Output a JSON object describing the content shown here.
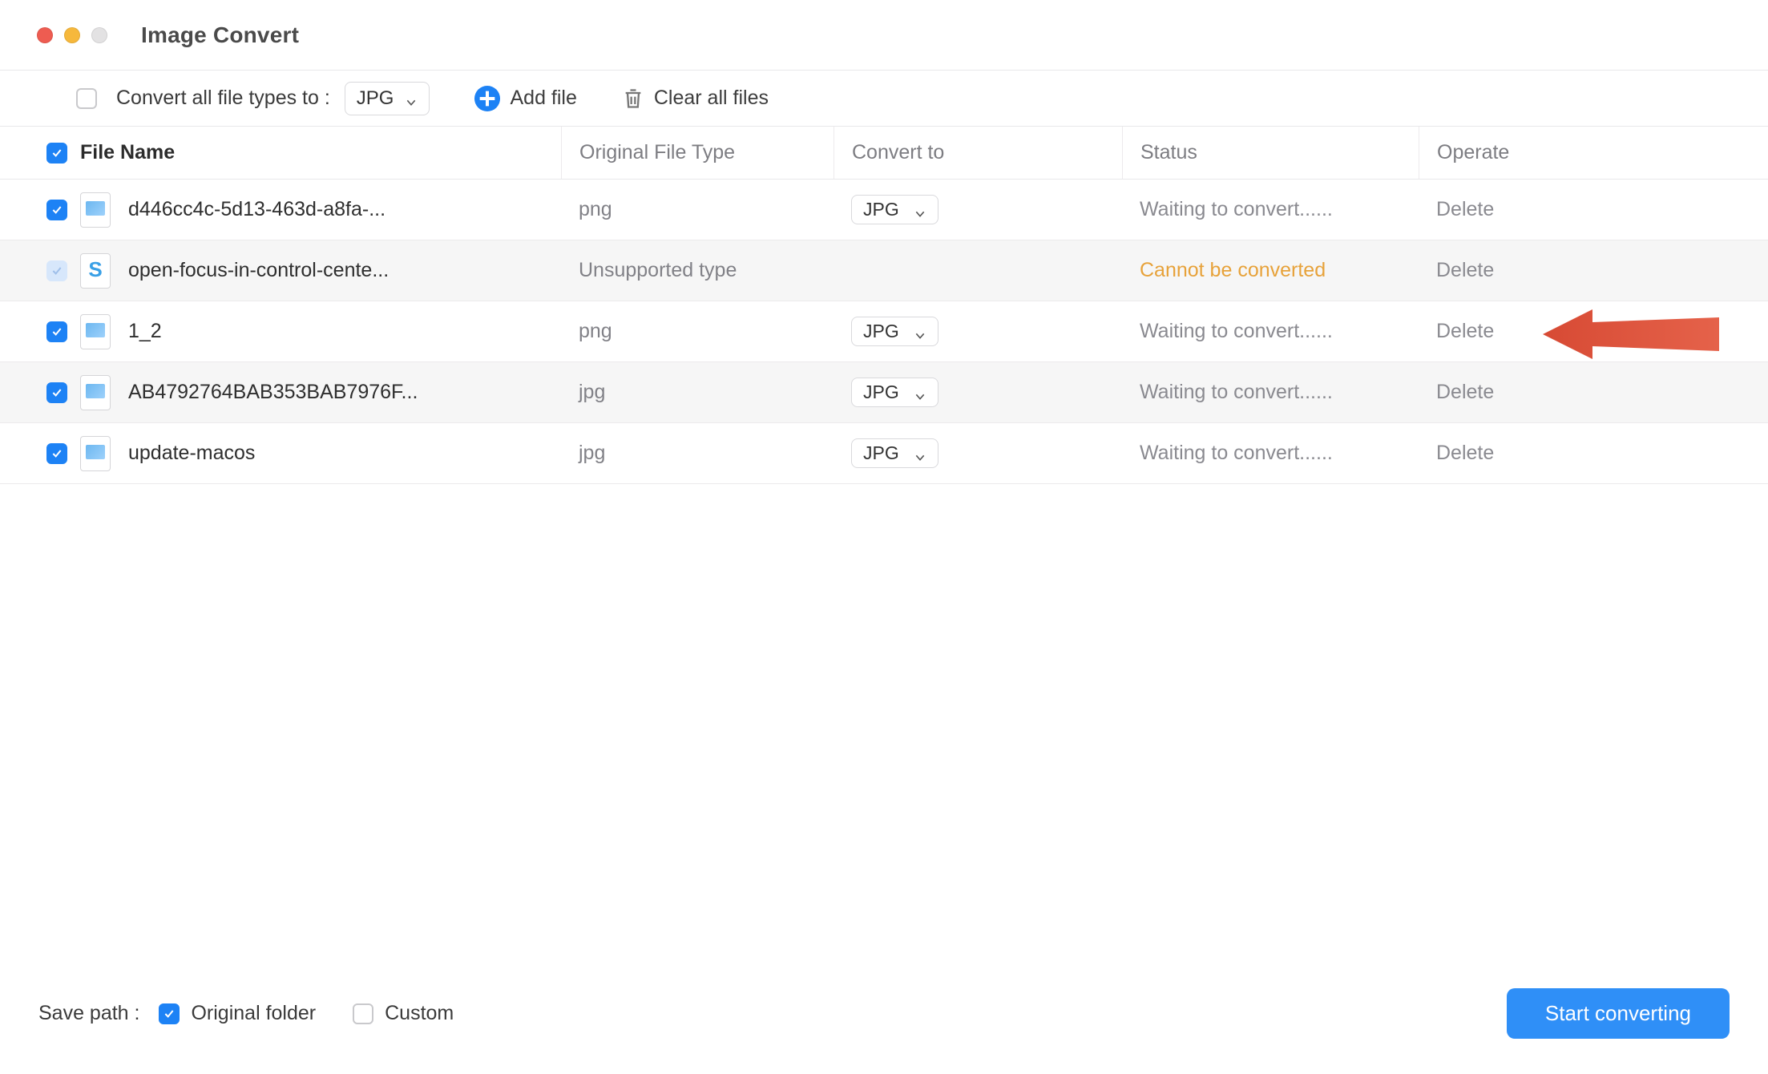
{
  "window": {
    "title": "Image Convert"
  },
  "toolbar": {
    "convert_all_label": "Convert all file types to :",
    "convert_all_value": "JPG",
    "add_file": "Add file",
    "clear_all": "Clear all files"
  },
  "columns": {
    "name": "File Name",
    "orig": "Original File Type",
    "conv": "Convert to",
    "status": "Status",
    "operate": "Operate"
  },
  "rows": [
    {
      "checked": true,
      "thumb": "img",
      "name": "d446cc4c-5d13-463d-a8fa-...",
      "orig": "png",
      "conv": "JPG",
      "status": "Waiting to convert......",
      "status_kind": "wait",
      "op": "Delete"
    },
    {
      "checked": true,
      "faded": true,
      "thumb": "svg",
      "name": "open-focus-in-control-cente...",
      "orig": "Unsupported type",
      "conv": "",
      "status": "Cannot be converted",
      "status_kind": "warn",
      "op": "Delete"
    },
    {
      "checked": true,
      "thumb": "img",
      "name": "1_2",
      "orig": "png",
      "conv": "JPG",
      "status": "Waiting to convert......",
      "status_kind": "wait",
      "op": "Delete"
    },
    {
      "checked": true,
      "thumb": "img",
      "name": "AB4792764BAB353BAB7976F...",
      "orig": "jpg",
      "conv": "JPG",
      "status": "Waiting to convert......",
      "status_kind": "wait",
      "op": "Delete"
    },
    {
      "checked": true,
      "thumb": "img",
      "name": "update-macos",
      "orig": "jpg",
      "conv": "JPG",
      "status": "Waiting to convert......",
      "status_kind": "wait",
      "op": "Delete"
    }
  ],
  "footer": {
    "save_path_label": "Save path :",
    "original_folder": "Original folder",
    "custom": "Custom",
    "start": "Start converting"
  }
}
